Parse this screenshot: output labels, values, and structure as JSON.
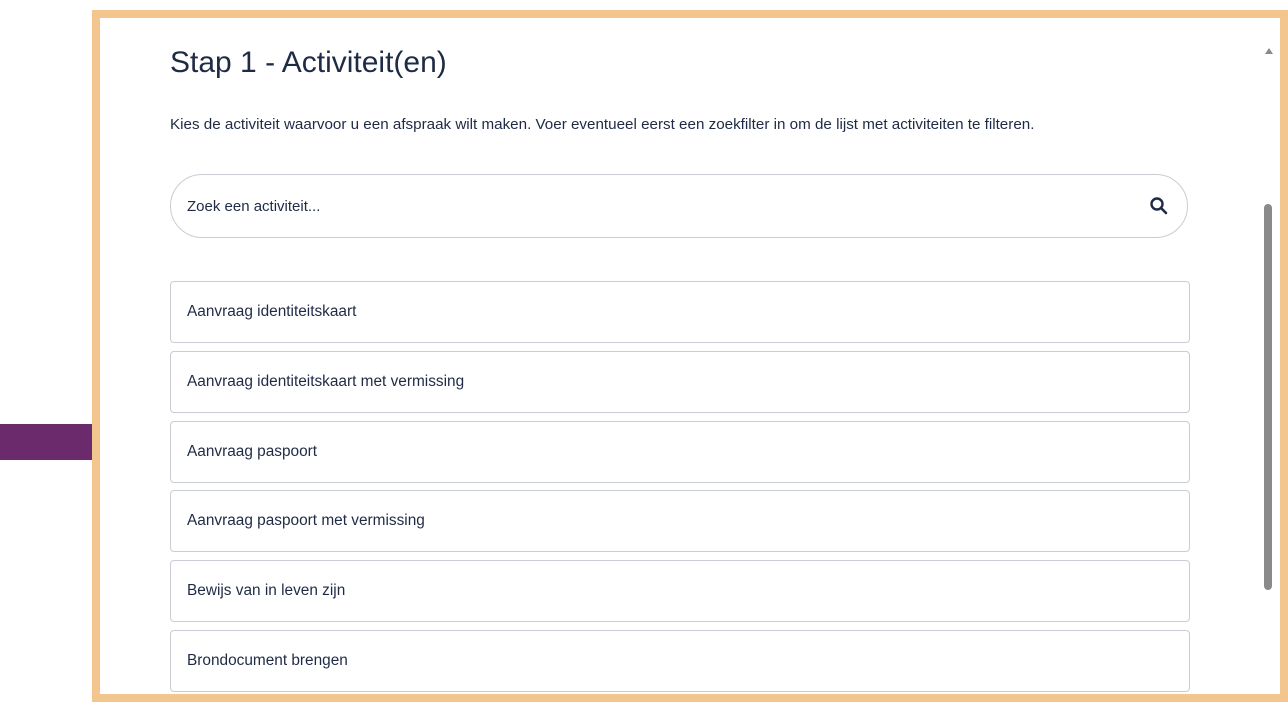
{
  "page": {
    "title": "Stap 1 - Activiteit(en)",
    "intro": "Kies de activiteit waarvoor u een afspraak wilt maken. Voer eventueel eerst een zoekfilter in om de lijst met activiteiten te filteren."
  },
  "search": {
    "placeholder": "Zoek een activiteit...",
    "value": "",
    "icon": "search-icon"
  },
  "activities": [
    {
      "label": "Aanvraag identiteitskaart"
    },
    {
      "label": "Aanvraag identiteitskaart met vermissing"
    },
    {
      "label": "Aanvraag paspoort",
      "highlighted": true
    },
    {
      "label": "Aanvraag paspoort met vermissing"
    },
    {
      "label": "Bewijs van in leven zijn"
    },
    {
      "label": "Brondocument brengen"
    }
  ],
  "colors": {
    "frame": "#f4c68f",
    "arrow": "#6b2a6b",
    "text": "#1f2a44",
    "border": "#c9cdd3"
  }
}
